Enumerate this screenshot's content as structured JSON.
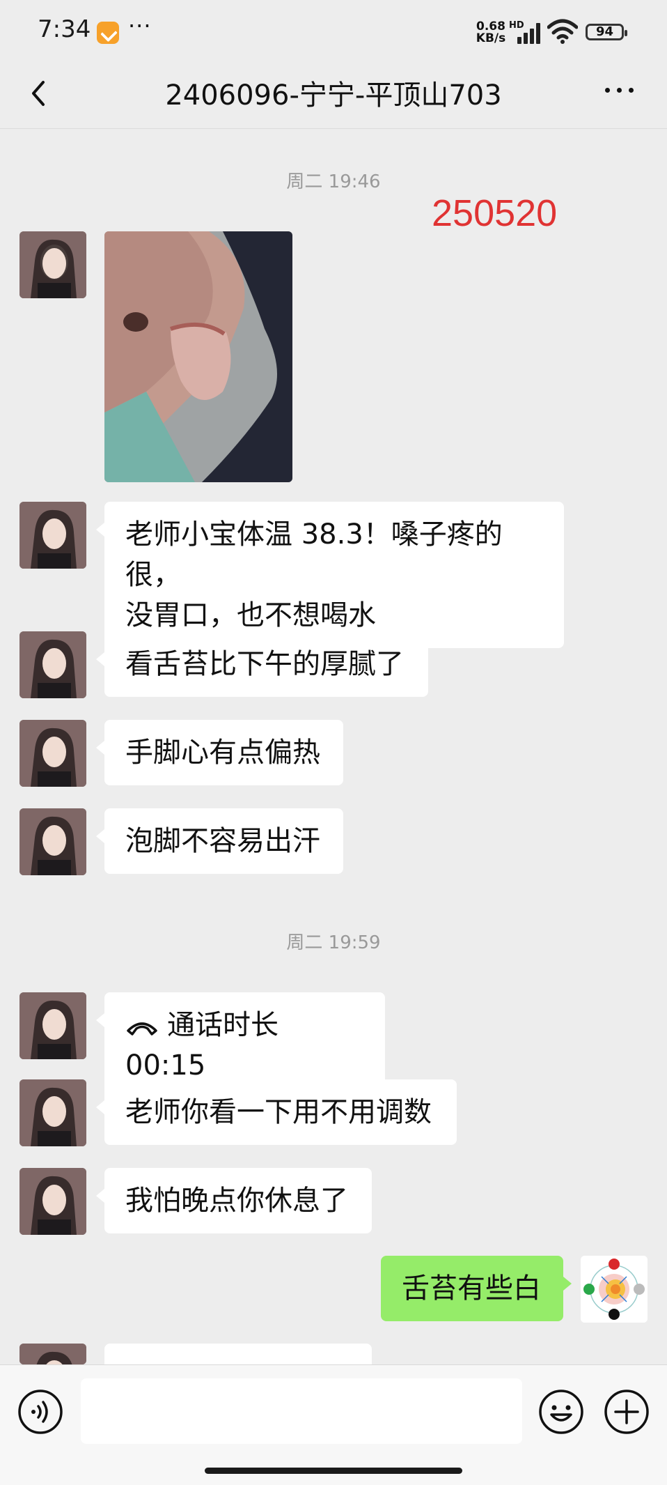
{
  "status_bar": {
    "time": "7:34",
    "more": "···",
    "net_speed_value": "0.68",
    "net_speed_unit": "KB/s",
    "hd": "HD",
    "battery": "94"
  },
  "header": {
    "title": "2406096-宁宁-平顶山703"
  },
  "annotation": "250520",
  "timestamps": [
    "周二 19:46",
    "周二 19:59"
  ],
  "messages": [
    {
      "text": "老师小宝体温 38.3！嗓子疼的很，"
    },
    {
      "text": "没胃口，也不想喝水"
    },
    {
      "text": "看舌苔比下午的厚腻了"
    },
    {
      "text": "手脚心有点偏热"
    },
    {
      "text": "泡脚不容易出汗"
    },
    {
      "text": "通话时长 00:15"
    },
    {
      "text": "老师你看一下用不用调数"
    },
    {
      "text": "我怕晚点你休息了"
    },
    {
      "text": "舌苔有些白"
    }
  ],
  "colors": {
    "background": "#ededed",
    "my_bubble": "#95ec69",
    "annotation": "#e03333"
  }
}
